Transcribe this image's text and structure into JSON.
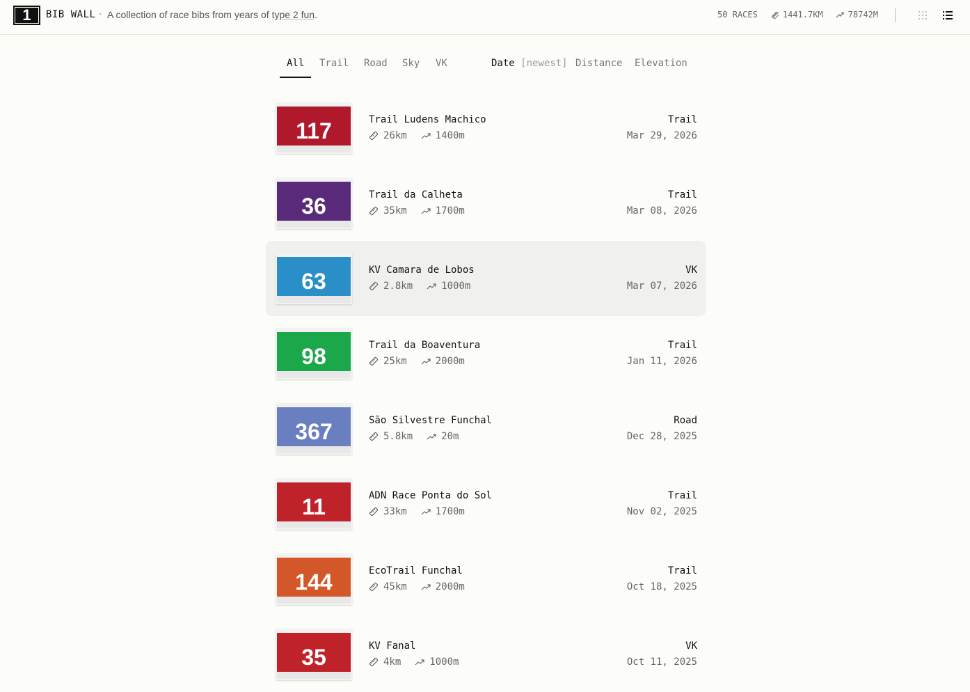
{
  "header": {
    "logo_text": "1",
    "brand": "BIB WALL",
    "separator": "·",
    "tagline_prefix": "A collection of race bibs from years of ",
    "tagline_link": "type 2 fun",
    "tagline_suffix": ".",
    "races": "50 RACES",
    "distance": "1441.7KM",
    "elevation": "78742M"
  },
  "filters": {
    "tabs": [
      "All",
      "Trail",
      "Road",
      "Sky",
      "VK"
    ],
    "active_tab": "All",
    "sort_date": "Date",
    "sort_order": "[newest]",
    "sort_distance": "Distance",
    "sort_elevation": "Elevation"
  },
  "races": [
    {
      "title": "Trail Ludens Machico",
      "distance": "26km",
      "elevation": "1400m",
      "type": "Trail",
      "date": "Mar 29, 2026",
      "bib_number": "117",
      "bib_color": "#b0182b"
    },
    {
      "title": "Trail da Calheta",
      "distance": "35km",
      "elevation": "1700m",
      "type": "Trail",
      "date": "Mar 08, 2026",
      "bib_number": "36",
      "bib_color": "#5a2a7a"
    },
    {
      "title": "KV Camara de Lobos",
      "distance": "2.8km",
      "elevation": "1000m",
      "type": "VK",
      "date": "Mar 07, 2026",
      "bib_number": "63",
      "bib_color": "#2a8fc8"
    },
    {
      "title": "Trail da Boaventura",
      "distance": "25km",
      "elevation": "2000m",
      "type": "Trail",
      "date": "Jan 11, 2026",
      "bib_number": "98",
      "bib_color": "#1aa84a"
    },
    {
      "title": "São Silvestre Funchal",
      "distance": "5.8km",
      "elevation": "20m",
      "type": "Road",
      "date": "Dec 28, 2025",
      "bib_number": "367",
      "bib_color": "#6a7fc0"
    },
    {
      "title": "ADN Race Ponta do Sol",
      "distance": "33km",
      "elevation": "1700m",
      "type": "Trail",
      "date": "Nov 02, 2025",
      "bib_number": "11",
      "bib_color": "#c0222a"
    },
    {
      "title": "EcoTrail Funchal",
      "distance": "45km",
      "elevation": "2000m",
      "type": "Trail",
      "date": "Oct 18, 2025",
      "bib_number": "144",
      "bib_color": "#d4572a"
    },
    {
      "title": "KV Fanal",
      "distance": "4km",
      "elevation": "1000m",
      "type": "VK",
      "date": "Oct 11, 2025",
      "bib_number": "35",
      "bib_color": "#c0222a"
    }
  ],
  "icons": {
    "distance": "ruler-icon",
    "elevation": "trend-up-icon",
    "grid_view": "grid-icon",
    "list_view": "list-icon"
  }
}
